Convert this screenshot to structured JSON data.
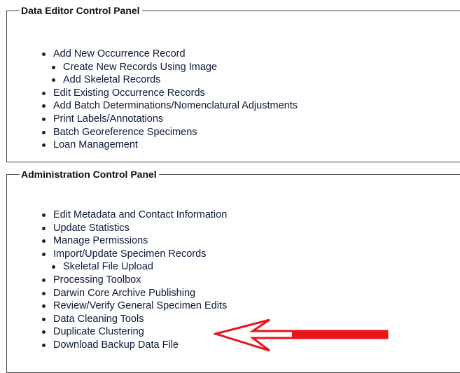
{
  "data_editor": {
    "title": "Data Editor Control Panel",
    "items": {
      "add_new_occurrence": "Add New Occurrence Record",
      "create_new_records_image": "Create New Records Using Image",
      "add_skeletal_records": "Add Skeletal Records",
      "edit_existing": "Edit Existing Occurrence Records",
      "add_batch_determinations": "Add Batch Determinations/Nomenclatural Adjustments",
      "print_labels": "Print Labels/Annotations",
      "batch_georeference": "Batch Georeference Specimens",
      "loan_management": "Loan Management"
    }
  },
  "administration": {
    "title": "Administration Control Panel",
    "items": {
      "edit_metadata": "Edit Metadata and Contact Information",
      "update_statistics": "Update Statistics",
      "manage_permissions": "Manage Permissions",
      "import_update": "Import/Update Specimen Records",
      "skeletal_file_upload": "Skeletal File Upload",
      "processing_toolbox": "Processing Toolbox",
      "darwin_core": "Darwin Core Archive Publishing",
      "review_verify": "Review/Verify General Specimen Edits",
      "data_cleaning": "Data Cleaning Tools",
      "duplicate_clustering": "Duplicate Clustering",
      "download_backup": "Download Backup Data File"
    }
  },
  "colors": {
    "link_text": "#0d1a3a",
    "annotation_arrow": "#e8151b"
  },
  "annotation": {
    "type": "arrow",
    "points_to": "Download Backup Data File"
  }
}
